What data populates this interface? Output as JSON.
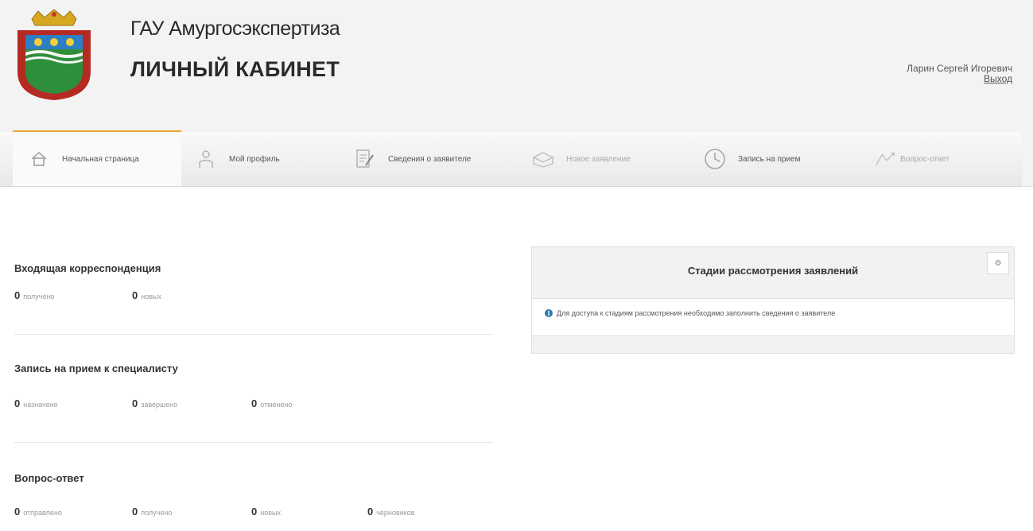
{
  "header": {
    "site_name": "ГАУ Амургосэкспертиза",
    "cabinet_title": "ЛИЧНЫЙ КАБИНЕТ",
    "user_name": "Ларин Сергей Игоревич",
    "logout": "Выход"
  },
  "nav": {
    "tabs": [
      {
        "label": "Начальная страница",
        "icon": "home-icon",
        "state": "active"
      },
      {
        "label": "Мой профиль",
        "icon": "profile-icon",
        "state": "normal"
      },
      {
        "label": "Сведения о заявителе",
        "icon": "document-edit-icon",
        "state": "normal"
      },
      {
        "label": "Новое заявление",
        "icon": "new-application-icon",
        "state": "disabled"
      },
      {
        "label": "Запись на прием",
        "icon": "clock-icon",
        "state": "normal"
      },
      {
        "label": "Вопрос-ответ",
        "icon": "question-answer-icon",
        "state": "disabled"
      }
    ]
  },
  "incoming": {
    "title": "Входящая корреспонденция",
    "received_count": "0",
    "received_label": "получено",
    "new_count": "0",
    "new_label": "новых"
  },
  "appointments": {
    "title": "Запись на прием к специалисту",
    "assigned_count": "0",
    "assigned_label": "назначено",
    "completed_count": "0",
    "completed_label": "завершено",
    "cancelled_count": "0",
    "cancelled_label": "отменено"
  },
  "qa": {
    "title": "Вопрос-ответ",
    "sent_count": "0",
    "sent_label": "отправлено",
    "received_count": "0",
    "received_label": "получено",
    "new_count": "0",
    "new_label": "новых",
    "drafts_count": "0",
    "drafts_label": "черновиков"
  },
  "stages_panel": {
    "title": "Стадии рассмотрения заявлений",
    "settings_icon": "gear-icon",
    "info_text": "Для доступа к стадиям рассмотрения необходимо заполнить сведения о заявителе"
  },
  "colors": {
    "accent": "#e8a92a",
    "info": "#2a7ab0",
    "header_bg": "#f3f3f3"
  }
}
